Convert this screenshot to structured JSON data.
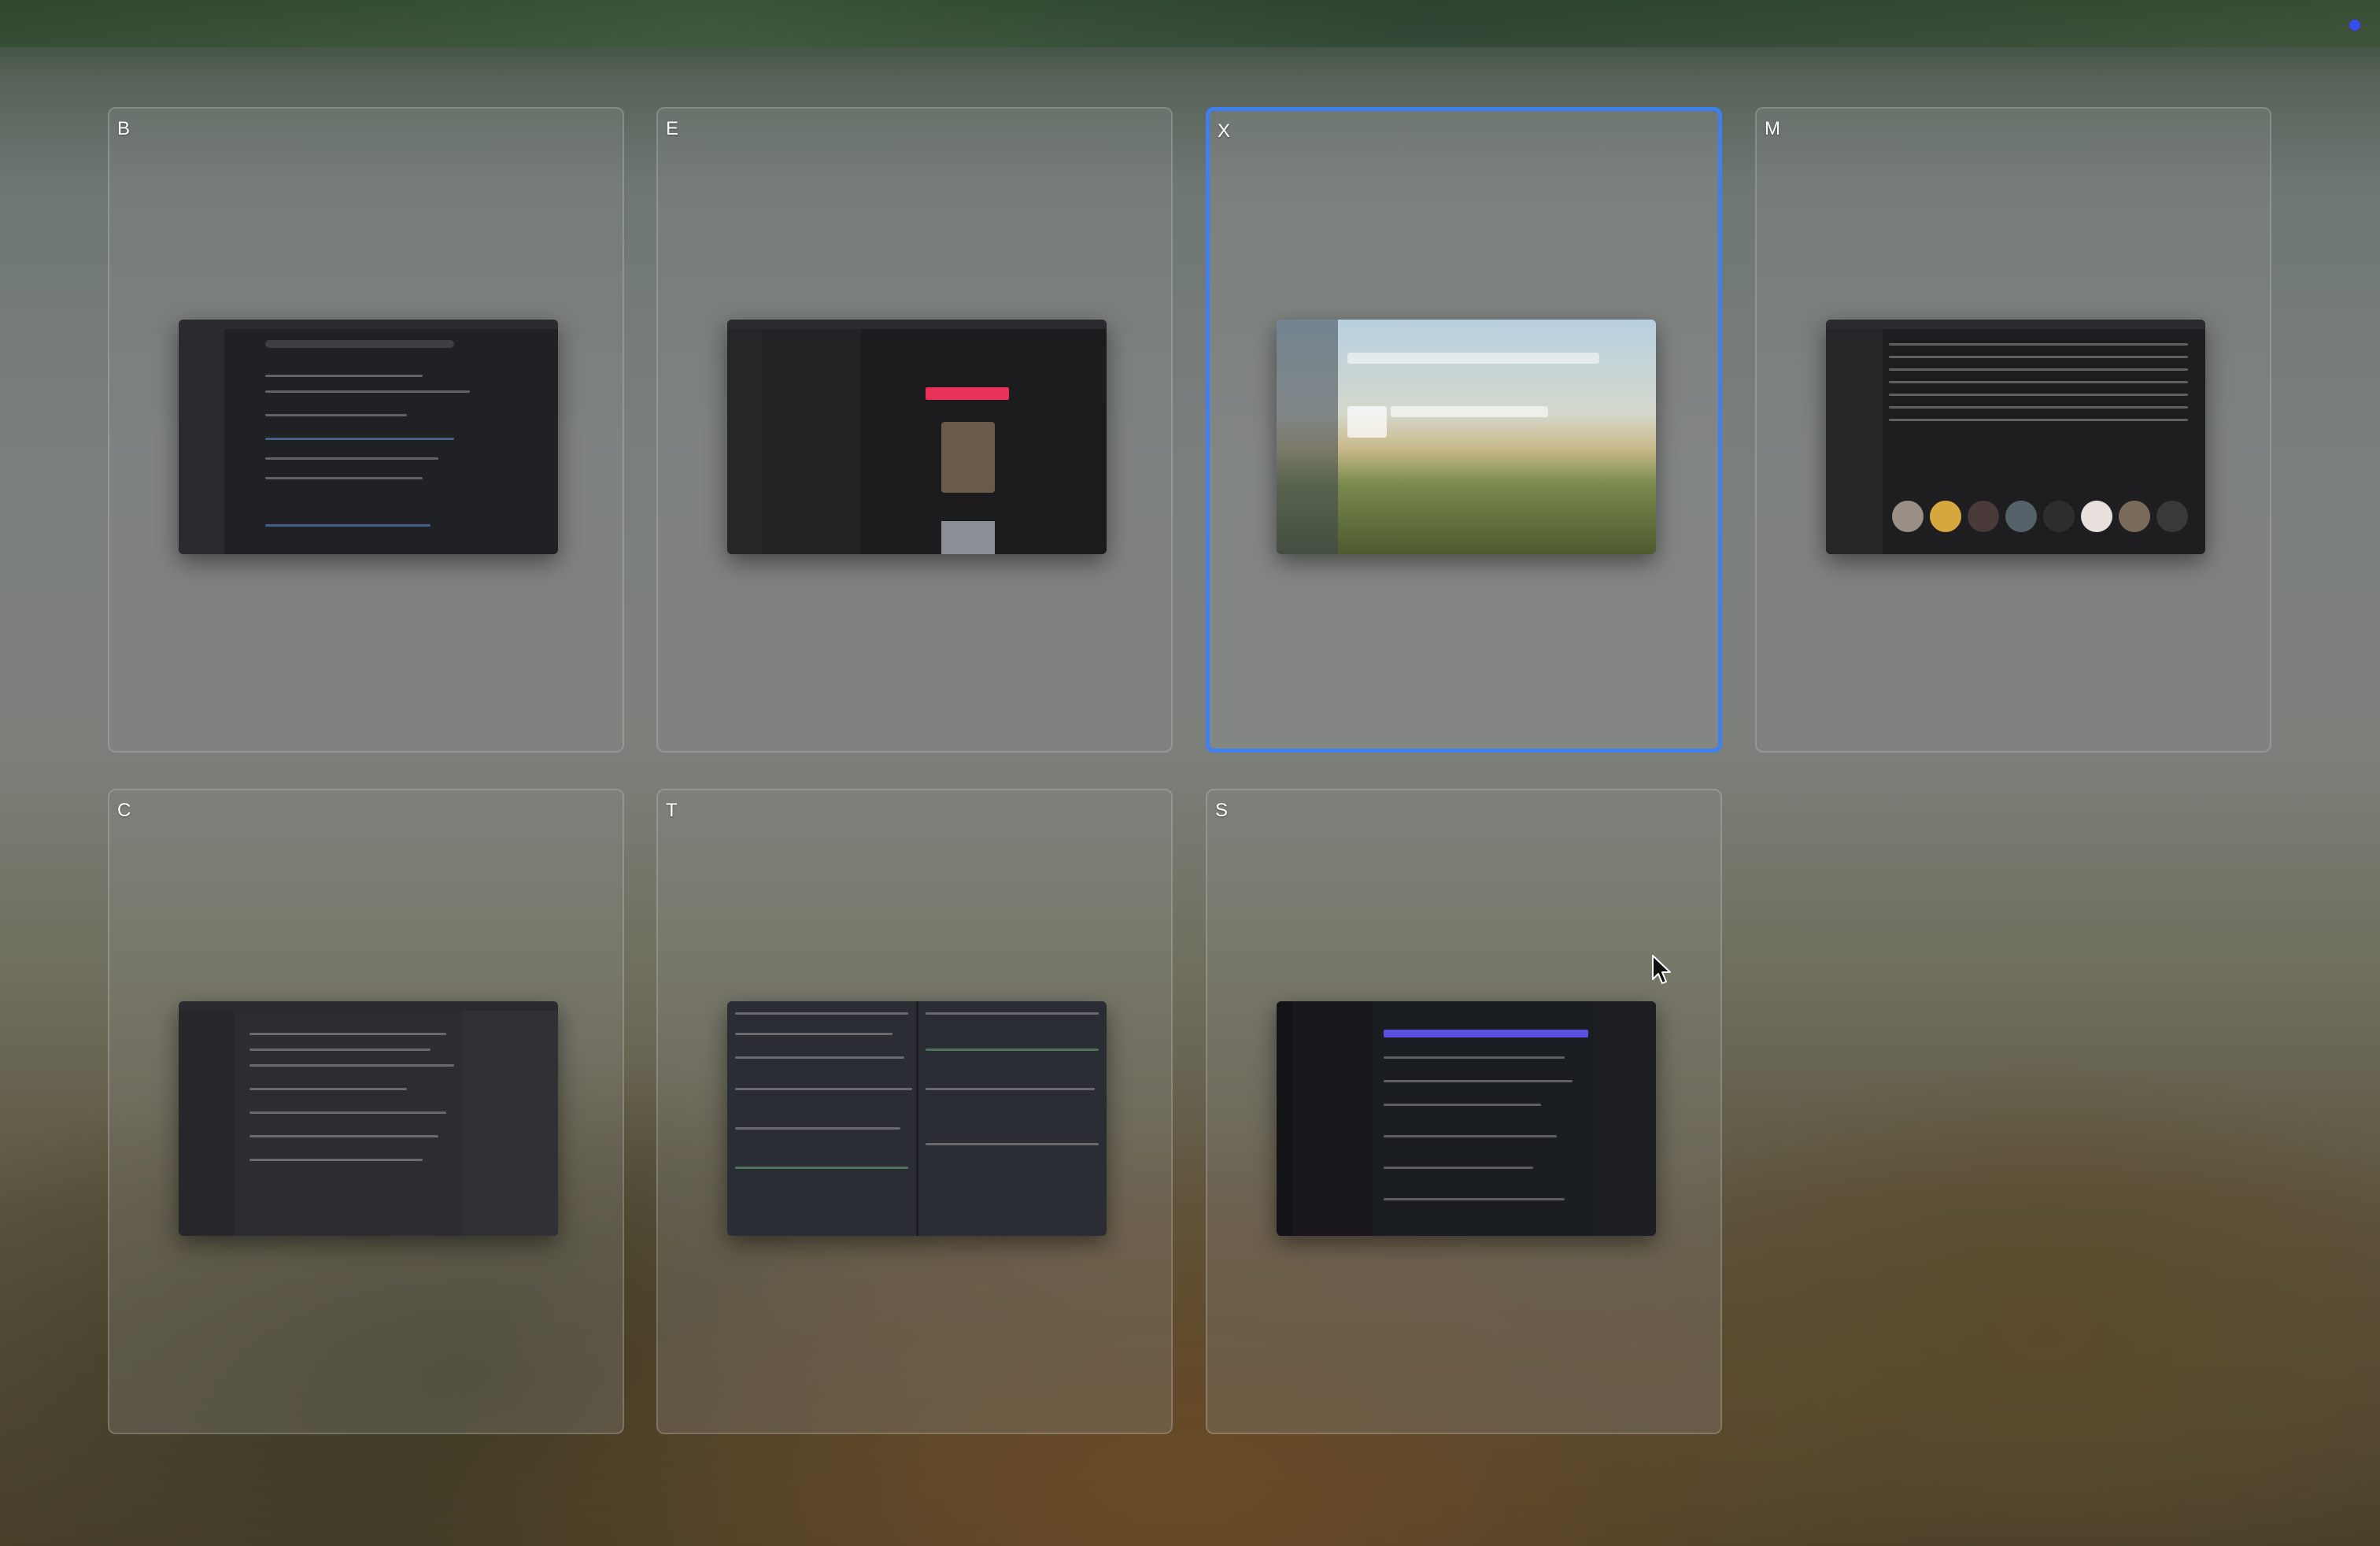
{
  "spaces": [
    {
      "label": "B",
      "app_icon": "browser-window",
      "title": ""
    },
    {
      "label": "E",
      "app_icon": "email-window",
      "title": ""
    },
    {
      "label": "X",
      "app_icon": "xcode-window",
      "title": ""
    },
    {
      "label": "M",
      "app_icon": "music-window",
      "title": ""
    },
    {
      "label": "C",
      "app_icon": "code-editor-window",
      "title": ""
    },
    {
      "label": "T",
      "app_icon": "terminal-window",
      "title": ""
    },
    {
      "label": "S",
      "app_icon": "slack-window",
      "title": ""
    }
  ],
  "active_space": "X",
  "colors": {
    "accent": "#3f7ff0",
    "status_dot": "#3a4cf0"
  }
}
